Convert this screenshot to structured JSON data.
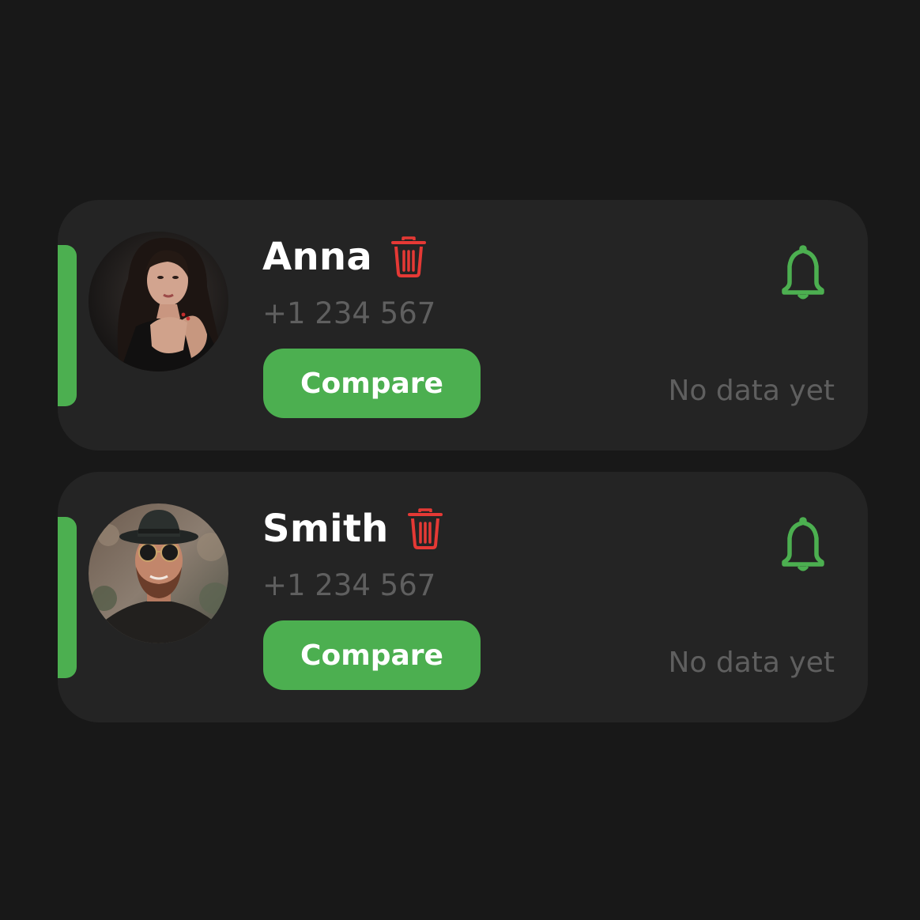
{
  "colors": {
    "background": "#181818",
    "card": "#242424",
    "accent": "#4CAF50",
    "delete": "#E53935",
    "muted_text": "#5f5f5f",
    "name_text": "#ffffff"
  },
  "contacts": [
    {
      "name": "Anna",
      "phone": "+1 234 567",
      "compare_label": "Compare",
      "status": "No data yet",
      "delete_icon": "trash-icon",
      "notify_icon": "bell-icon"
    },
    {
      "name": "Smith",
      "phone": "+1 234 567",
      "compare_label": "Compare",
      "status": "No data yet",
      "delete_icon": "trash-icon",
      "notify_icon": "bell-icon"
    }
  ]
}
